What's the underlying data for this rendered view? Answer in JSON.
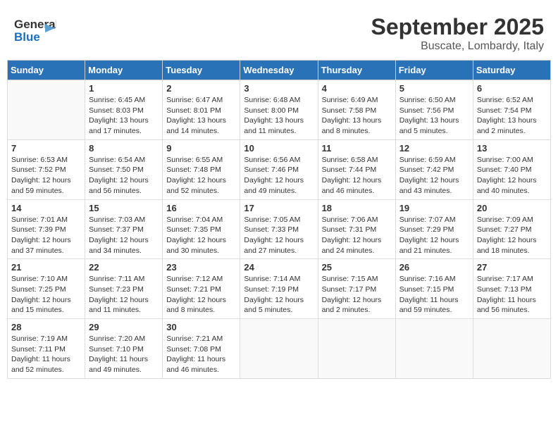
{
  "header": {
    "logo_general": "General",
    "logo_blue": "Blue",
    "title": "September 2025",
    "subtitle": "Buscate, Lombardy, Italy"
  },
  "days_of_week": [
    "Sunday",
    "Monday",
    "Tuesday",
    "Wednesday",
    "Thursday",
    "Friday",
    "Saturday"
  ],
  "weeks": [
    [
      {
        "day": "",
        "sunrise": "",
        "sunset": "",
        "daylight": ""
      },
      {
        "day": "1",
        "sunrise": "Sunrise: 6:45 AM",
        "sunset": "Sunset: 8:03 PM",
        "daylight": "Daylight: 13 hours and 17 minutes."
      },
      {
        "day": "2",
        "sunrise": "Sunrise: 6:47 AM",
        "sunset": "Sunset: 8:01 PM",
        "daylight": "Daylight: 13 hours and 14 minutes."
      },
      {
        "day": "3",
        "sunrise": "Sunrise: 6:48 AM",
        "sunset": "Sunset: 8:00 PM",
        "daylight": "Daylight: 13 hours and 11 minutes."
      },
      {
        "day": "4",
        "sunrise": "Sunrise: 6:49 AM",
        "sunset": "Sunset: 7:58 PM",
        "daylight": "Daylight: 13 hours and 8 minutes."
      },
      {
        "day": "5",
        "sunrise": "Sunrise: 6:50 AM",
        "sunset": "Sunset: 7:56 PM",
        "daylight": "Daylight: 13 hours and 5 minutes."
      },
      {
        "day": "6",
        "sunrise": "Sunrise: 6:52 AM",
        "sunset": "Sunset: 7:54 PM",
        "daylight": "Daylight: 13 hours and 2 minutes."
      }
    ],
    [
      {
        "day": "7",
        "sunrise": "Sunrise: 6:53 AM",
        "sunset": "Sunset: 7:52 PM",
        "daylight": "Daylight: 12 hours and 59 minutes."
      },
      {
        "day": "8",
        "sunrise": "Sunrise: 6:54 AM",
        "sunset": "Sunset: 7:50 PM",
        "daylight": "Daylight: 12 hours and 56 minutes."
      },
      {
        "day": "9",
        "sunrise": "Sunrise: 6:55 AM",
        "sunset": "Sunset: 7:48 PM",
        "daylight": "Daylight: 12 hours and 52 minutes."
      },
      {
        "day": "10",
        "sunrise": "Sunrise: 6:56 AM",
        "sunset": "Sunset: 7:46 PM",
        "daylight": "Daylight: 12 hours and 49 minutes."
      },
      {
        "day": "11",
        "sunrise": "Sunrise: 6:58 AM",
        "sunset": "Sunset: 7:44 PM",
        "daylight": "Daylight: 12 hours and 46 minutes."
      },
      {
        "day": "12",
        "sunrise": "Sunrise: 6:59 AM",
        "sunset": "Sunset: 7:42 PM",
        "daylight": "Daylight: 12 hours and 43 minutes."
      },
      {
        "day": "13",
        "sunrise": "Sunrise: 7:00 AM",
        "sunset": "Sunset: 7:40 PM",
        "daylight": "Daylight: 12 hours and 40 minutes."
      }
    ],
    [
      {
        "day": "14",
        "sunrise": "Sunrise: 7:01 AM",
        "sunset": "Sunset: 7:39 PM",
        "daylight": "Daylight: 12 hours and 37 minutes."
      },
      {
        "day": "15",
        "sunrise": "Sunrise: 7:03 AM",
        "sunset": "Sunset: 7:37 PM",
        "daylight": "Daylight: 12 hours and 34 minutes."
      },
      {
        "day": "16",
        "sunrise": "Sunrise: 7:04 AM",
        "sunset": "Sunset: 7:35 PM",
        "daylight": "Daylight: 12 hours and 30 minutes."
      },
      {
        "day": "17",
        "sunrise": "Sunrise: 7:05 AM",
        "sunset": "Sunset: 7:33 PM",
        "daylight": "Daylight: 12 hours and 27 minutes."
      },
      {
        "day": "18",
        "sunrise": "Sunrise: 7:06 AM",
        "sunset": "Sunset: 7:31 PM",
        "daylight": "Daylight: 12 hours and 24 minutes."
      },
      {
        "day": "19",
        "sunrise": "Sunrise: 7:07 AM",
        "sunset": "Sunset: 7:29 PM",
        "daylight": "Daylight: 12 hours and 21 minutes."
      },
      {
        "day": "20",
        "sunrise": "Sunrise: 7:09 AM",
        "sunset": "Sunset: 7:27 PM",
        "daylight": "Daylight: 12 hours and 18 minutes."
      }
    ],
    [
      {
        "day": "21",
        "sunrise": "Sunrise: 7:10 AM",
        "sunset": "Sunset: 7:25 PM",
        "daylight": "Daylight: 12 hours and 15 minutes."
      },
      {
        "day": "22",
        "sunrise": "Sunrise: 7:11 AM",
        "sunset": "Sunset: 7:23 PM",
        "daylight": "Daylight: 12 hours and 11 minutes."
      },
      {
        "day": "23",
        "sunrise": "Sunrise: 7:12 AM",
        "sunset": "Sunset: 7:21 PM",
        "daylight": "Daylight: 12 hours and 8 minutes."
      },
      {
        "day": "24",
        "sunrise": "Sunrise: 7:14 AM",
        "sunset": "Sunset: 7:19 PM",
        "daylight": "Daylight: 12 hours and 5 minutes."
      },
      {
        "day": "25",
        "sunrise": "Sunrise: 7:15 AM",
        "sunset": "Sunset: 7:17 PM",
        "daylight": "Daylight: 12 hours and 2 minutes."
      },
      {
        "day": "26",
        "sunrise": "Sunrise: 7:16 AM",
        "sunset": "Sunset: 7:15 PM",
        "daylight": "Daylight: 11 hours and 59 minutes."
      },
      {
        "day": "27",
        "sunrise": "Sunrise: 7:17 AM",
        "sunset": "Sunset: 7:13 PM",
        "daylight": "Daylight: 11 hours and 56 minutes."
      }
    ],
    [
      {
        "day": "28",
        "sunrise": "Sunrise: 7:19 AM",
        "sunset": "Sunset: 7:11 PM",
        "daylight": "Daylight: 11 hours and 52 minutes."
      },
      {
        "day": "29",
        "sunrise": "Sunrise: 7:20 AM",
        "sunset": "Sunset: 7:10 PM",
        "daylight": "Daylight: 11 hours and 49 minutes."
      },
      {
        "day": "30",
        "sunrise": "Sunrise: 7:21 AM",
        "sunset": "Sunset: 7:08 PM",
        "daylight": "Daylight: 11 hours and 46 minutes."
      },
      {
        "day": "",
        "sunrise": "",
        "sunset": "",
        "daylight": ""
      },
      {
        "day": "",
        "sunrise": "",
        "sunset": "",
        "daylight": ""
      },
      {
        "day": "",
        "sunrise": "",
        "sunset": "",
        "daylight": ""
      },
      {
        "day": "",
        "sunrise": "",
        "sunset": "",
        "daylight": ""
      }
    ]
  ]
}
